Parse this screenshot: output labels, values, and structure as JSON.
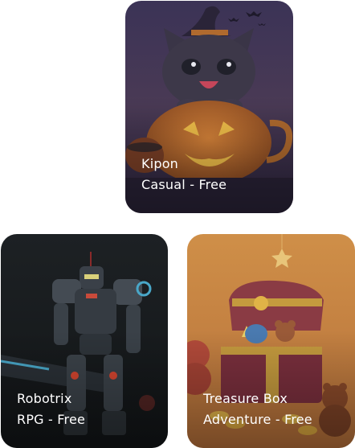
{
  "games": [
    {
      "title": "Kipon",
      "subtitle": "Casual - Free"
    },
    {
      "title": "Robotrix",
      "subtitle": "RPG - Free"
    },
    {
      "title": "Treasure Box",
      "subtitle": "Adventure - Free"
    }
  ]
}
